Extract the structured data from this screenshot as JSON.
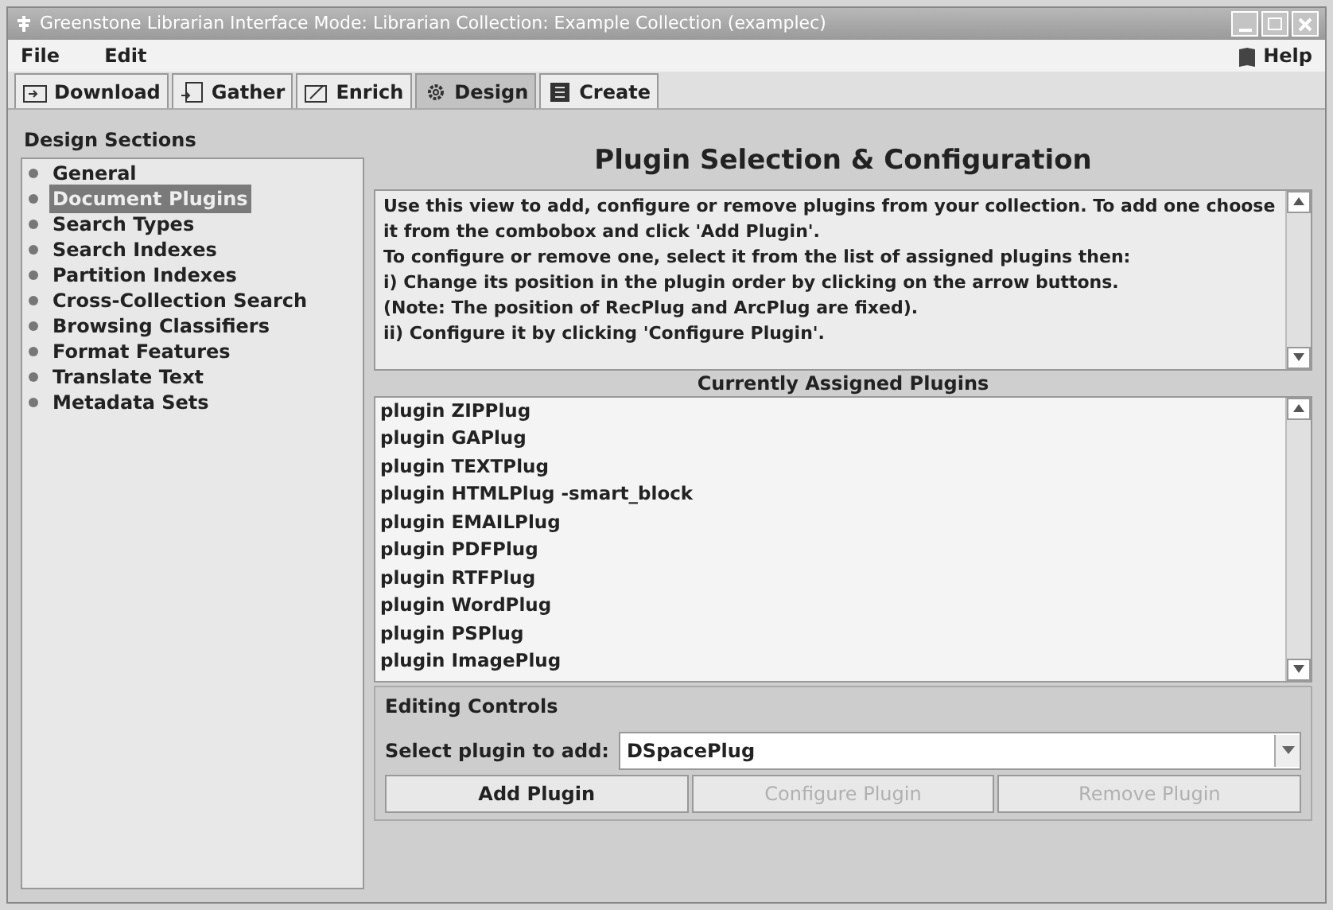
{
  "window": {
    "title": "Greenstone Librarian Interface  Mode: Librarian  Collection: Example Collection (examplec)"
  },
  "menu": [
    "File",
    "Edit"
  ],
  "help": "Help",
  "tabs": [
    {
      "label": "Download",
      "selected": false
    },
    {
      "label": "Gather",
      "selected": false
    },
    {
      "label": "Enrich",
      "selected": false
    },
    {
      "label": "Design",
      "selected": true
    },
    {
      "label": "Create",
      "selected": false
    }
  ],
  "sidebar": {
    "title": "Design Sections",
    "items": [
      {
        "label": "General",
        "selected": false
      },
      {
        "label": "Document Plugins",
        "selected": true
      },
      {
        "label": "Search Types",
        "selected": false
      },
      {
        "label": "Search Indexes",
        "selected": false
      },
      {
        "label": "Partition Indexes",
        "selected": false
      },
      {
        "label": "Cross-Collection Search",
        "selected": false
      },
      {
        "label": "Browsing Classifiers",
        "selected": false
      },
      {
        "label": "Format Features",
        "selected": false
      },
      {
        "label": "Translate Text",
        "selected": false
      },
      {
        "label": "Metadata Sets",
        "selected": false
      }
    ]
  },
  "heading": "Plugin Selection & Configuration",
  "instructions": [
    "Use this view to add, configure or remove plugins from your collection. To add one choose it from the combobox and click 'Add Plugin'.",
    "To configure or remove one, select it from the list of assigned plugins then:",
    "i)   Change its position in the plugin order by clicking on the arrow buttons.",
    "(Note: The position of RecPlug and ArcPlug are fixed).",
    "ii)  Configure it by clicking 'Configure Plugin'."
  ],
  "assigned": {
    "title": "Currently Assigned Plugins",
    "items": [
      "plugin ZIPPlug",
      "plugin GAPlug",
      "plugin TEXTPlug",
      "plugin HTMLPlug -smart_block",
      "plugin EMAILPlug",
      "plugin PDFPlug",
      "plugin RTFPlug",
      "plugin WordPlug",
      "plugin PSPlug",
      "plugin ImagePlug"
    ]
  },
  "editing": {
    "title": "Editing Controls",
    "select_label": "Select plugin to add:",
    "select_value": "DSpacePlug",
    "buttons": [
      {
        "label": "Add Plugin",
        "disabled": false
      },
      {
        "label": "Configure Plugin",
        "disabled": true
      },
      {
        "label": "Remove Plugin",
        "disabled": true
      }
    ]
  }
}
